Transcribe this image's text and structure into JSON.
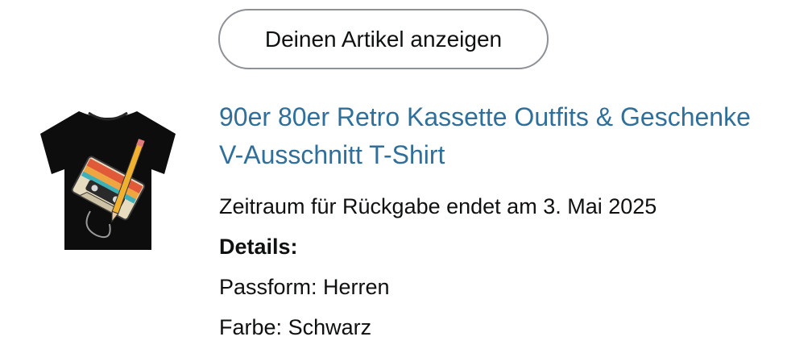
{
  "buttons": {
    "view_item": "Deinen Artikel anzeigen"
  },
  "product": {
    "title_line1": "90er 80er Retro Kassette Outfits & Geschenke",
    "title_line2": "V-Ausschnitt T-Shirt",
    "return_window": "Zeitraum für Rückgabe endet am 3. Mai 2025",
    "details_label": "Details:",
    "fit_label": "Passform:",
    "fit_value": "Herren",
    "color_label": "Farbe:",
    "color_value": "Schwarz",
    "image_icon": "t-shirt-cassette-image"
  },
  "colors": {
    "link": "#2f6f9a",
    "text": "#0f1111",
    "button_border": "#8d9096"
  }
}
